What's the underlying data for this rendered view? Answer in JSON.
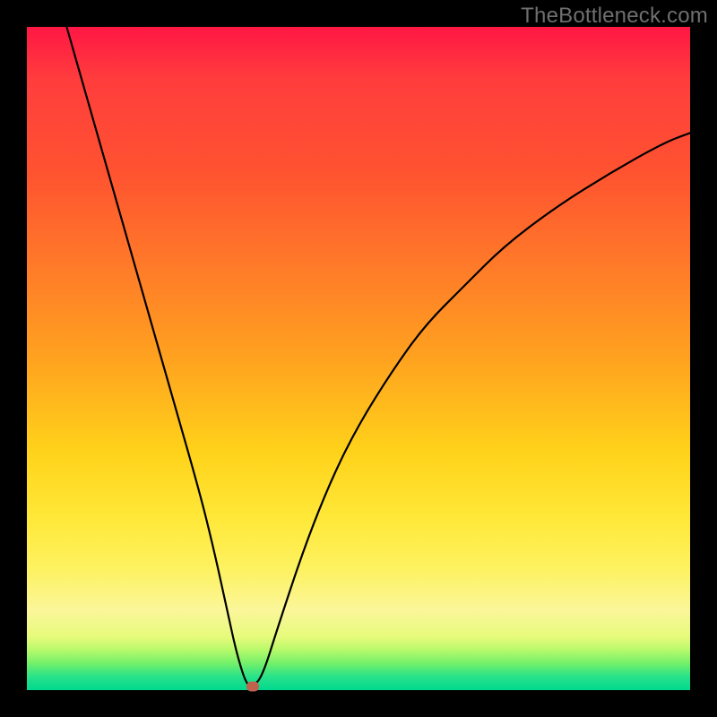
{
  "watermark": "TheBottleneck.com",
  "chart_data": {
    "type": "line",
    "title": "",
    "xlabel": "",
    "ylabel": "",
    "xlim": [
      0,
      100
    ],
    "ylim": [
      0,
      100
    ],
    "series": [
      {
        "name": "curve",
        "x": [
          6,
          10,
          14,
          18,
          22,
          26,
          28,
          30,
          31.5,
          33,
          34,
          35.5,
          38,
          42,
          46,
          50,
          55,
          60,
          66,
          72,
          80,
          88,
          96,
          100
        ],
        "values": [
          100,
          86,
          72,
          58,
          44,
          30,
          22,
          13,
          6,
          1,
          0.5,
          2,
          10,
          22,
          32,
          40,
          48,
          55,
          61,
          67,
          73,
          78,
          82.5,
          84
        ]
      }
    ],
    "marker": {
      "x": 34,
      "y": 0.5
    },
    "gradient_stops": [
      {
        "pct": 0,
        "color": "#ff1744"
      },
      {
        "pct": 22,
        "color": "#ff5330"
      },
      {
        "pct": 50,
        "color": "#ffa21f"
      },
      {
        "pct": 74,
        "color": "#ffe838"
      },
      {
        "pct": 92,
        "color": "#e6fb7b"
      },
      {
        "pct": 100,
        "color": "#00d88e"
      }
    ]
  }
}
